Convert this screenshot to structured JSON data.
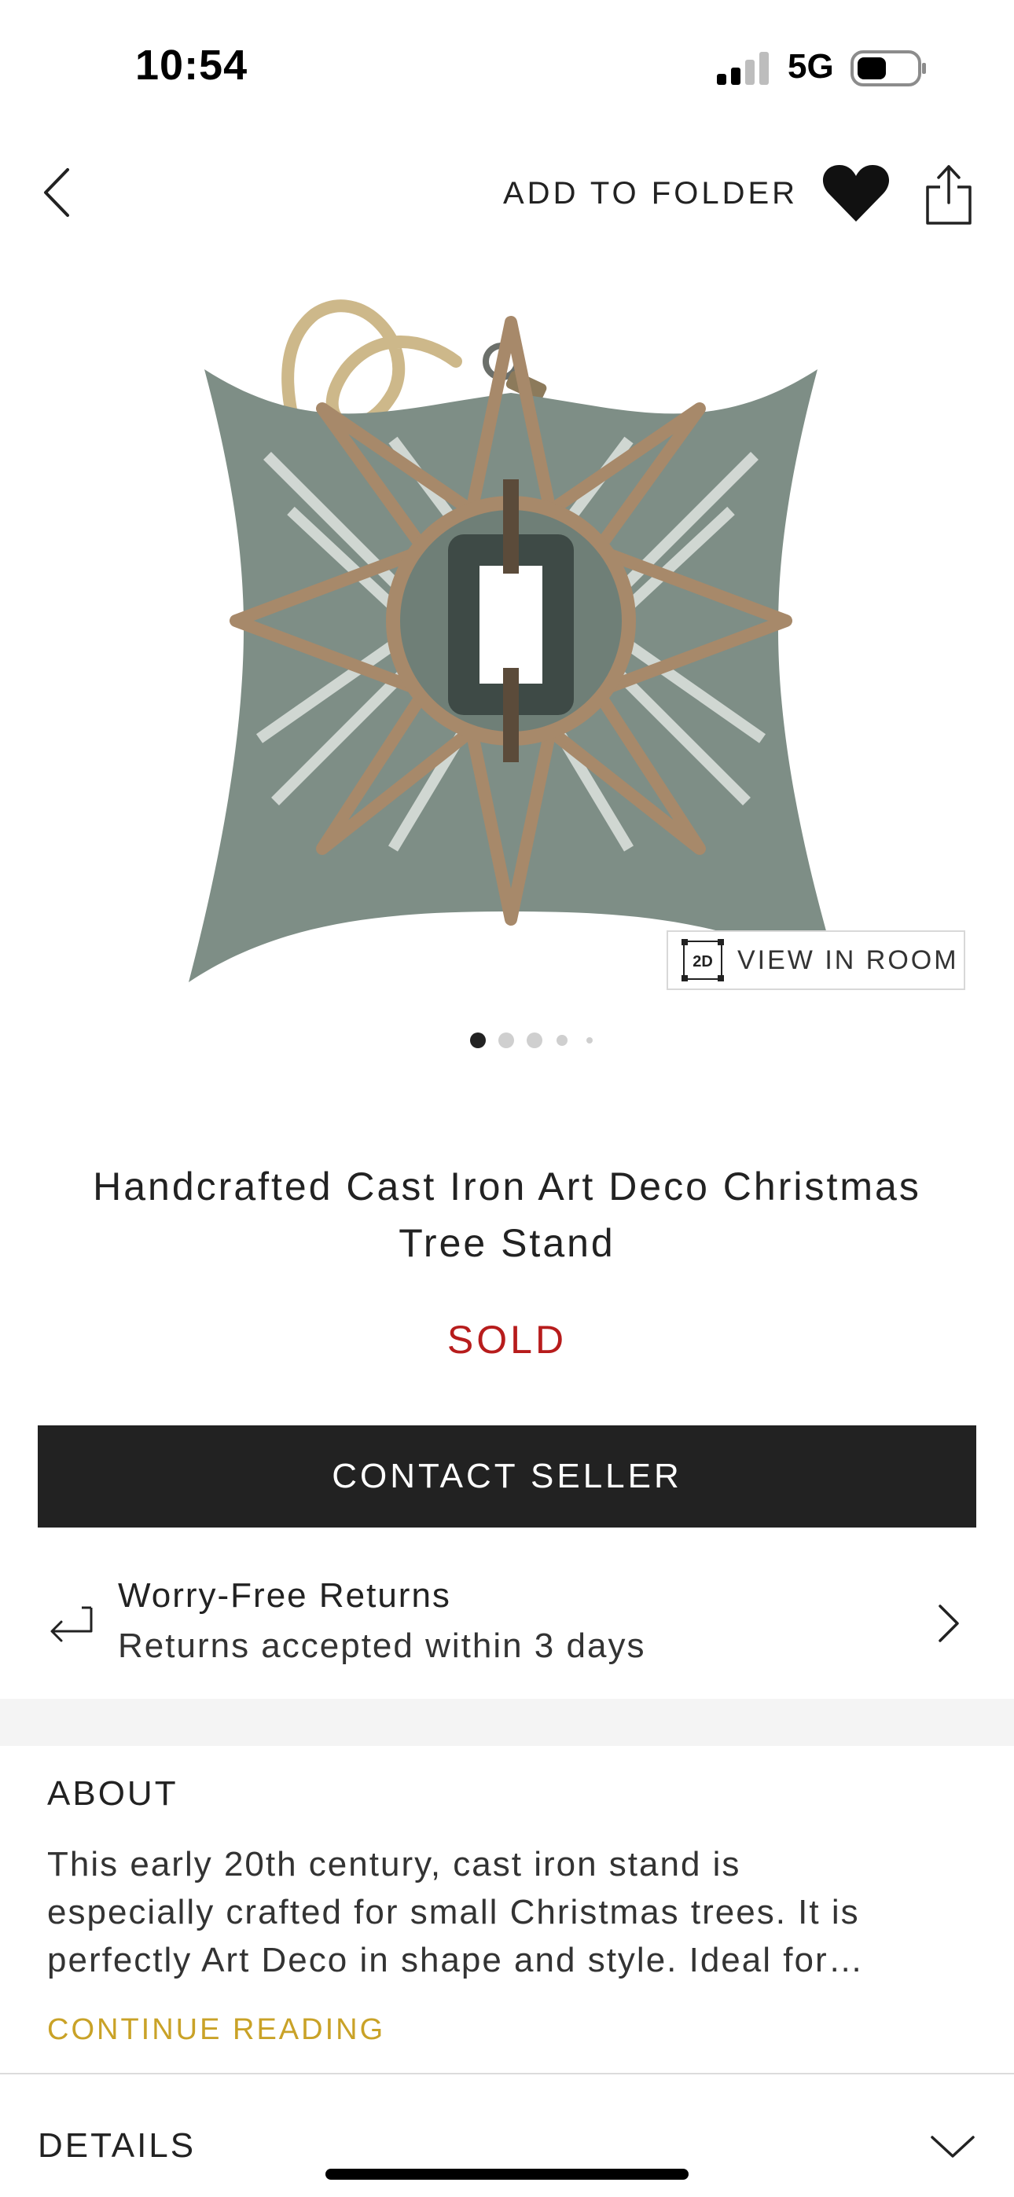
{
  "status_bar": {
    "time": "10:54",
    "network": "5G",
    "icons": [
      "signal-icon",
      "battery-icon"
    ]
  },
  "nav": {
    "back_icon": "chevron-left-icon",
    "add_to_folder_label": "ADD TO FOLDER",
    "favorite_icon": "heart-icon",
    "share_icon": "share-icon"
  },
  "product": {
    "image_description_icon": "tree-stand-image",
    "view_in_room_badge": "2D",
    "view_in_room_label": "VIEW IN ROOM",
    "carousel": {
      "total": 5,
      "active_index": 0
    },
    "title_line1": "Handcrafted Cast Iron Art Deco Christmas",
    "title_line2": "Tree Stand",
    "status": "SOLD",
    "status_color": "#b71c1c"
  },
  "contact_seller_label": "CONTACT SELLER",
  "returns": {
    "icon": "return-arrow-icon",
    "title": "Worry-Free Returns",
    "subtitle": "Returns accepted within 3 days"
  },
  "about": {
    "heading": "ABOUT",
    "lines": [
      "This early 20th century, cast iron stand is",
      "especially crafted for small Christmas trees. It is",
      "perfectly Art Deco in shape and style. Ideal for…"
    ],
    "continue_label": "CONTINUE READING",
    "accent_color": "#c9a227"
  },
  "details": {
    "heading": "DETAILS",
    "icon": "chevron-down-icon"
  }
}
